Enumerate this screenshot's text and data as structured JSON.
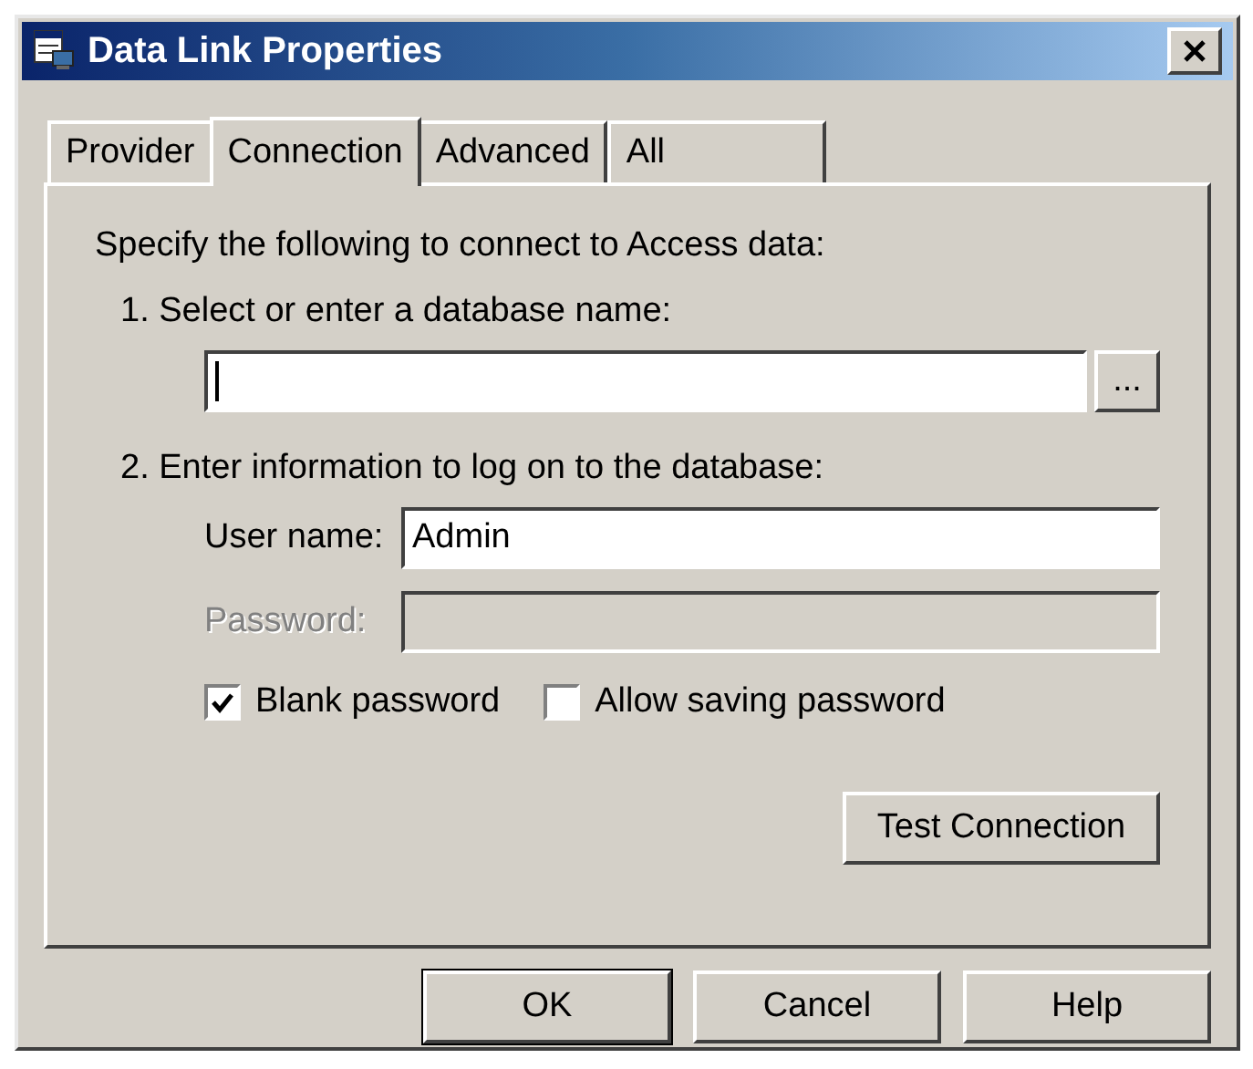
{
  "window": {
    "title": "Data Link Properties"
  },
  "tabs": [
    {
      "label": "Provider",
      "selected": false
    },
    {
      "label": "Connection",
      "selected": true
    },
    {
      "label": "Advanced",
      "selected": false
    },
    {
      "label": "All",
      "selected": false
    }
  ],
  "intro": "Specify the following to connect to Access data:",
  "step_1": {
    "label": "1. Select or enter a database name:",
    "database_field": {
      "focused": true
    },
    "browse_button": "..."
  },
  "step_2": {
    "label": "2. Enter information to log on to the database:",
    "fields": [
      {
        "label": "User name:",
        "value": "Admin",
        "disabled": false
      },
      {
        "label": "Password:",
        "disabled": true
      }
    ],
    "checkboxes": [
      {
        "label": "Blank password",
        "checked": true
      },
      {
        "label": "Allow saving password",
        "checked": false
      }
    ],
    "test_button": "Test Connection"
  },
  "buttons": [
    {
      "label": "OK",
      "default": true
    },
    {
      "label": "Cancel",
      "default": false
    },
    {
      "label": "Help",
      "default": false
    }
  ]
}
